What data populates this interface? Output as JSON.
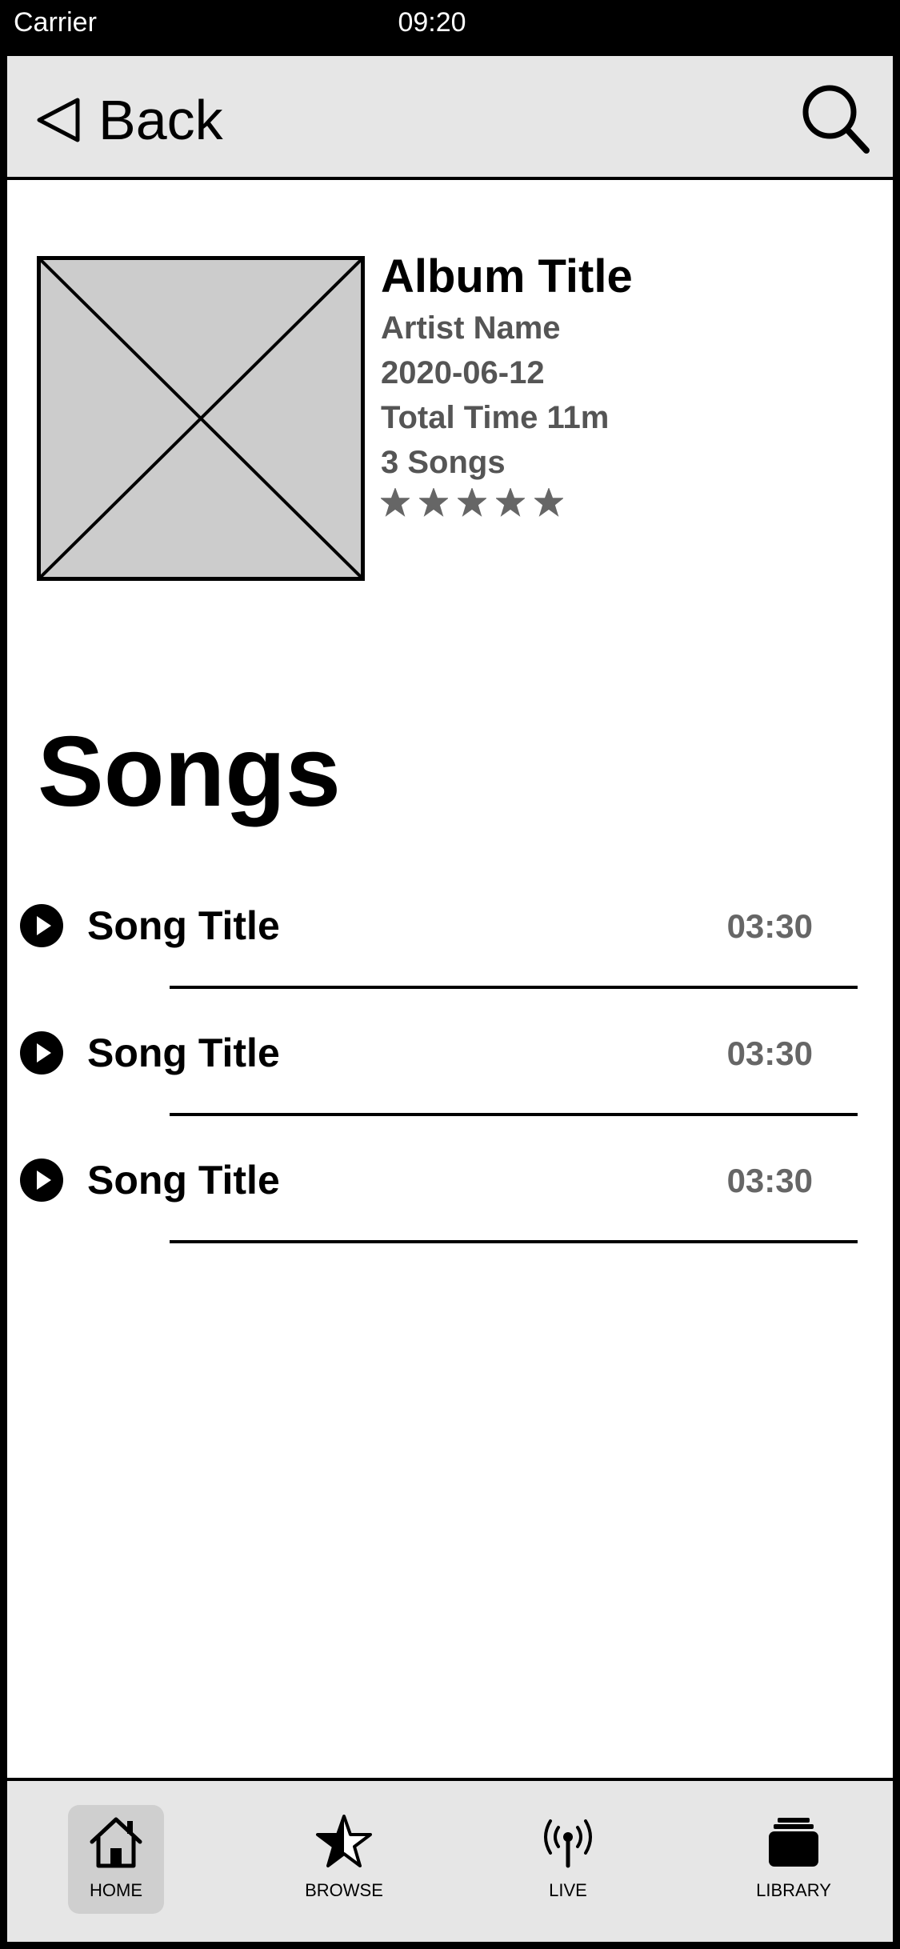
{
  "status_bar": {
    "carrier": "Carrier",
    "time": "09:20"
  },
  "nav": {
    "back_label": "Back",
    "search_icon": "search-icon",
    "back_icon": "back-triangle-icon"
  },
  "album": {
    "title": "Album Title",
    "artist": "Artist Name",
    "date": "2020-06-12",
    "total_time": "Total Time 11m",
    "song_count": "3 Songs",
    "rating": 5,
    "rating_max": 5
  },
  "songs_section": {
    "title": "Songs",
    "items": [
      {
        "title": "Song Title",
        "duration": "03:30"
      },
      {
        "title": "Song Title",
        "duration": "03:30"
      },
      {
        "title": "Song Title",
        "duration": "03:30"
      }
    ]
  },
  "tab_bar": {
    "tabs": [
      {
        "label": "HOME",
        "icon": "home-icon",
        "active": true
      },
      {
        "label": "BROWSE",
        "icon": "star-icon",
        "active": false
      },
      {
        "label": "LIVE",
        "icon": "broadcast-icon",
        "active": false
      },
      {
        "label": "LIBRARY",
        "icon": "library-icon",
        "active": false
      }
    ]
  },
  "colors": {
    "bar_background": "#e6e6e6",
    "placeholder_fill": "#cccccc",
    "muted_text": "#555555",
    "star_color": "#666666",
    "active_tab": "#cfcfcf"
  }
}
